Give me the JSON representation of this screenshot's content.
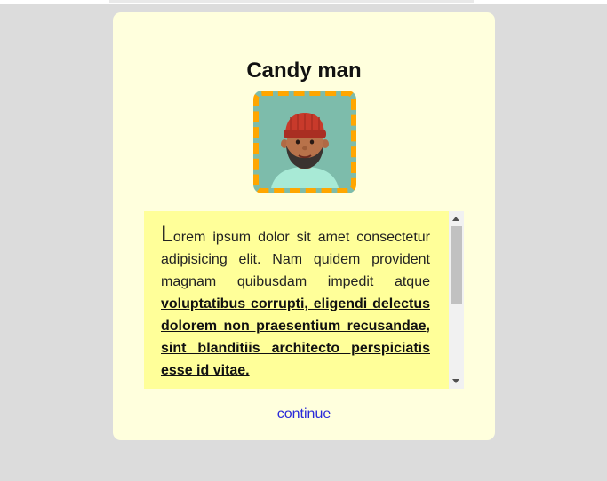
{
  "dialog": {
    "title": "Candy man",
    "avatar_alt": "avatar",
    "text": {
      "dropcap": "L",
      "plain": "orem ipsum dolor sit amet consectetur adipisicing elit. Nam quidem provident magnam quibusdam impedit atque ",
      "underlined": "voluptatibus corrupti, eligendi delectus dolorem non praesentium recusandae, sint blanditiis architecto perspiciatis esse id vitae."
    },
    "continue_label": "continue"
  },
  "colors": {
    "page_background": "#dcdcdc",
    "card_background": "#ffffdd",
    "text_box_background": "#ffff99",
    "avatar_border": "#ffa600",
    "link": "#2a2ad9"
  },
  "icons": {
    "avatar": "person-avatar-illustration"
  }
}
